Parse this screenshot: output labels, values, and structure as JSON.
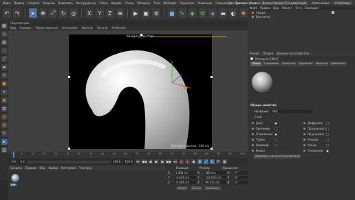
{
  "menubar": {
    "items": [
      "Файл",
      "Правка",
      "Создать",
      "Режимы",
      "Выделить",
      "Инструменты",
      "Сетка",
      "Каркас",
      "Стиль",
      "Объекты",
      "Теги",
      "MoGraph",
      "Персонаж",
      "Анимация",
      "Симуляция",
      "Трекер",
      "Рендеринг"
    ],
    "right_items": [
      "Пространство узлов",
      "Демонстрация (Стандартный)",
      "Компоновка",
      "Стартовая"
    ]
  },
  "viewport": {
    "header": "Перспектива",
    "menu": [
      "Вид",
      "Камеры",
      "Представление",
      "Настройки",
      "Фильтр",
      "Панели",
      "ProRender"
    ],
    "camera_label": "Камера редактора",
    "render_info": "Интервал растра : 100 cm"
  },
  "object_manager": {
    "tabs": [
      "Файл",
      "Правка",
      "Вид",
      "Объект",
      "Теги",
      "Закладки"
    ],
    "rows": [
      {
        "name": "Сфера"
      },
      {
        "name": "Магнитно"
      }
    ]
  },
  "attribute_manager": {
    "menu": [
      "Режим",
      "Правка",
      "Данные пользователя"
    ],
    "material_title": "Материал [Mat]",
    "tabs": [
      "Общее",
      "Отражения",
      "Смещение",
      "Подсветка",
      "Редактор",
      "Применить"
    ],
    "section_title": "Общие свойства",
    "name_label": "Название",
    "name_value": "Mat",
    "layer_label": "Слой",
    "channels": [
      {
        "label": "Цвет",
        "on": true
      },
      {
        "label": "Диффузия",
        "on": false
      },
      {
        "label": "Свечение",
        "on": false
      },
      {
        "label": "Прозрачность",
        "on": false
      },
      {
        "label": "Отражение",
        "on": true
      },
      {
        "label": "Окружение",
        "on": false
      },
      {
        "label": "Туман",
        "on": false
      },
      {
        "label": "Рельеф",
        "on": false
      },
      {
        "label": "Нормали",
        "on": false
      },
      {
        "label": "Альфа",
        "on": false
      },
      {
        "label": "Накал",
        "on": false
      },
      {
        "label": "Смещение",
        "on": true
      }
    ],
    "add_layer_button": "Добавить канал пользователя"
  },
  "timeline": {
    "ticks": [
      "0",
      "5",
      "10",
      "15",
      "20",
      "25",
      "30",
      "35",
      "40",
      "45",
      "50",
      "55",
      "60",
      "65",
      "70",
      "75",
      "80",
      "85",
      "90",
      "95",
      "100"
    ],
    "frame_current": "0 K",
    "frame_start": "0 K",
    "frame_end": "100 K",
    "frame_max": "100 K",
    "end_label": "0 K"
  },
  "material_manager": {
    "menu": [
      "Создать",
      "Правка",
      "Вид",
      "Выбор",
      "Материал",
      "Текстура"
    ],
    "material_name": "Mat"
  },
  "coordinates": {
    "headers": [
      "Позиция",
      "Размер",
      "Вращение"
    ],
    "rows": [
      {
        "axis": "X",
        "pos": "1.356 cm",
        "size": "180 cm",
        "rot_axis": "H",
        "rot": "0 °"
      },
      {
        "axis": "Y",
        "pos": "-4.039 cm",
        "size": "114.653 cm",
        "rot_axis": "P",
        "rot": "0 °"
      },
      {
        "axis": "Z",
        "pos": "-0.684 cm",
        "size": "99.412 cm",
        "rot_axis": "B",
        "rot": "0 °"
      }
    ],
    "buttons": [
      "Объект",
      "Размер",
      "Применить"
    ]
  },
  "colors": {
    "accent": "#4e86c6",
    "orange": "#e38a2e",
    "background": "#2b2b2b"
  }
}
